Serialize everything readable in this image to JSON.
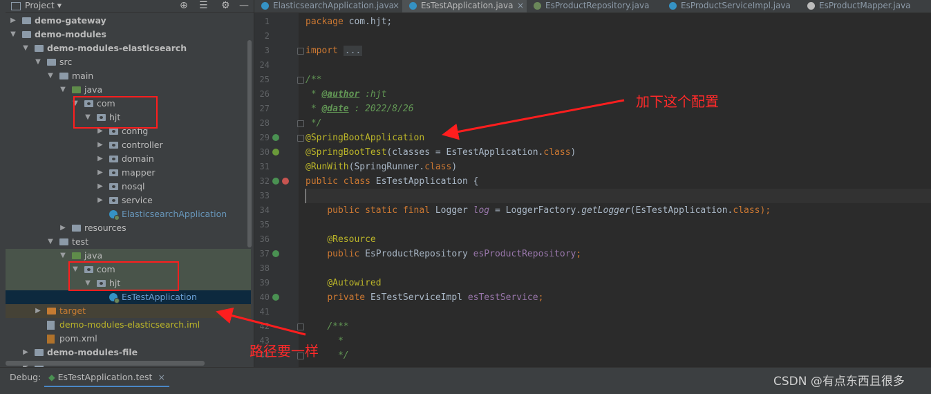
{
  "project_panel": {
    "title": "Project",
    "tree": [
      {
        "label": "demo-gateway",
        "bold": true,
        "indent": 0,
        "arrow": "right",
        "icon": "module"
      },
      {
        "label": "demo-modules",
        "bold": true,
        "indent": 0,
        "arrow": "down",
        "icon": "module"
      },
      {
        "label": "demo-modules-elasticsearch",
        "bold": true,
        "indent": 1,
        "arrow": "down",
        "icon": "module"
      },
      {
        "label": "src",
        "indent": 2,
        "arrow": "down",
        "icon": "folder"
      },
      {
        "label": "main",
        "indent": 3,
        "arrow": "down",
        "icon": "folder"
      },
      {
        "label": "java",
        "indent": 4,
        "arrow": "down",
        "icon": "source-folder"
      },
      {
        "label": "com",
        "indent": 5,
        "arrow": "down",
        "icon": "package"
      },
      {
        "label": "hjt",
        "indent": 6,
        "arrow": "down",
        "icon": "package"
      },
      {
        "label": "config",
        "indent": 7,
        "arrow": "right",
        "icon": "package"
      },
      {
        "label": "controller",
        "indent": 7,
        "arrow": "right",
        "icon": "package"
      },
      {
        "label": "domain",
        "indent": 7,
        "arrow": "right",
        "icon": "package"
      },
      {
        "label": "mapper",
        "indent": 7,
        "arrow": "right",
        "icon": "package"
      },
      {
        "label": "nosql",
        "indent": 7,
        "arrow": "right",
        "icon": "package"
      },
      {
        "label": "service",
        "indent": 7,
        "arrow": "right",
        "icon": "package"
      },
      {
        "label": "ElasticsearchApplication",
        "indent": 7,
        "arrow": "none",
        "icon": "spring-class",
        "color": "#6897bb"
      },
      {
        "label": "resources",
        "indent": 4,
        "arrow": "right",
        "icon": "resources"
      },
      {
        "label": "test",
        "indent": 3,
        "arrow": "down",
        "icon": "folder"
      },
      {
        "label": "java",
        "indent": 4,
        "arrow": "down",
        "icon": "test-folder",
        "zone": "test"
      },
      {
        "label": "com",
        "indent": 5,
        "arrow": "down",
        "icon": "package",
        "zone": "test"
      },
      {
        "label": "hjt",
        "indent": 6,
        "arrow": "down",
        "icon": "package",
        "zone": "test"
      },
      {
        "label": "EsTestApplication",
        "indent": 7,
        "arrow": "none",
        "icon": "spring-class",
        "color": "#6a9fd4",
        "selected": true
      },
      {
        "label": "target",
        "indent": 2,
        "arrow": "right",
        "icon": "excluded-folder",
        "color": "#c57b32",
        "zone": "excluded"
      },
      {
        "label": "demo-modules-elasticsearch.iml",
        "indent": 2,
        "arrow": "none",
        "icon": "iml-file",
        "color": "#bbb529"
      },
      {
        "label": "pom.xml",
        "indent": 2,
        "arrow": "none",
        "icon": "maven-file"
      },
      {
        "label": "demo-modules-file",
        "bold": true,
        "indent": 1,
        "arrow": "right",
        "icon": "module"
      },
      {
        "label": "demo-modules-system",
        "bold": true,
        "indent": 1,
        "arrow": "right",
        "icon": "module",
        "partial": true
      }
    ]
  },
  "tabs": [
    {
      "label": "ElasticsearchApplication.java",
      "icon_color": "#3592c4",
      "closable": true
    },
    {
      "label": "EsTestApplication.java",
      "icon_color": "#3592c4",
      "closable": true,
      "active": true
    },
    {
      "label": "EsProductRepository.java",
      "icon_color": "#6a8759"
    },
    {
      "label": "EsProductServiceImpl.java",
      "icon_color": "#3592c4"
    },
    {
      "label": "EsProductMapper.java",
      "icon_color": "#bbbbbb"
    }
  ],
  "editor": {
    "line_numbers": [
      "1",
      "2",
      "3",
      "24",
      "25",
      "26",
      "27",
      "28",
      "29",
      "30",
      "31",
      "32",
      "33",
      "34",
      "35",
      "36",
      "37",
      "38",
      "39",
      "40",
      "41",
      "42",
      "43",
      "44"
    ],
    "lines": [
      {
        "segs": [
          [
            "kw",
            "package "
          ],
          [
            "",
            "com.hjt;"
          ]
        ]
      },
      {
        "segs": []
      },
      {
        "segs": [
          [
            "kw",
            "import "
          ],
          [
            "fol",
            "..."
          ]
        ]
      },
      {
        "segs": []
      },
      {
        "segs": [
          [
            "cm",
            "/**"
          ]
        ]
      },
      {
        "segs": [
          [
            "cm",
            " * "
          ],
          [
            "tg",
            "@author"
          ],
          [
            "cm",
            " :hjt"
          ]
        ]
      },
      {
        "segs": [
          [
            "cm",
            " * "
          ],
          [
            "tg",
            "@date"
          ],
          [
            "cm",
            " : 2022/8/26"
          ]
        ]
      },
      {
        "segs": [
          [
            "cm",
            " */"
          ]
        ]
      },
      {
        "segs": [
          [
            "an",
            "@SpringBootApplication"
          ]
        ]
      },
      {
        "segs": [
          [
            "an",
            "@SpringBootTest"
          ],
          [
            "",
            "(classes = EsTestApplication."
          ],
          [
            "kw",
            "class"
          ],
          [
            "",
            ")"
          ]
        ]
      },
      {
        "segs": [
          [
            "an",
            "@RunWith"
          ],
          [
            "",
            "(SpringRunner."
          ],
          [
            "kw",
            "class"
          ],
          [
            "",
            ")"
          ]
        ]
      },
      {
        "segs": [
          [
            "kw",
            "public class "
          ],
          [
            "",
            "EsTestApplication {"
          ]
        ]
      },
      {
        "segs": [],
        "current": true
      },
      {
        "segs": [
          [
            "",
            "    "
          ],
          [
            "kw",
            "public static final "
          ],
          [
            "",
            "Logger "
          ],
          [
            "st",
            "log"
          ],
          [
            "",
            " = LoggerFactory."
          ],
          [
            "mth",
            "getLogger"
          ],
          [
            "",
            "(EsTestApplication."
          ],
          [
            "kw",
            "class"
          ],
          [
            "kw",
            ");"
          ]
        ]
      },
      {
        "segs": []
      },
      {
        "segs": [
          [
            "",
            "    "
          ],
          [
            "an",
            "@Resource"
          ]
        ]
      },
      {
        "segs": [
          [
            "",
            "    "
          ],
          [
            "kw",
            "public "
          ],
          [
            "",
            "EsProductRepository "
          ],
          [
            "fld",
            "esProductRepository"
          ],
          [
            "kw",
            ";"
          ]
        ]
      },
      {
        "segs": []
      },
      {
        "segs": [
          [
            "",
            "    "
          ],
          [
            "an",
            "@Autowired"
          ]
        ]
      },
      {
        "segs": [
          [
            "",
            "    "
          ],
          [
            "kw",
            "private "
          ],
          [
            "",
            "EsTestServiceImpl "
          ],
          [
            "fld",
            "esTestService"
          ],
          [
            "kw",
            ";"
          ]
        ]
      },
      {
        "segs": []
      },
      {
        "segs": [
          [
            "",
            "    "
          ],
          [
            "cm",
            "/***"
          ]
        ]
      },
      {
        "segs": [
          [
            "",
            "    "
          ],
          [
            "cm",
            "  *"
          ]
        ]
      },
      {
        "segs": [
          [
            "",
            "    "
          ],
          [
            "cm",
            "  */"
          ]
        ]
      }
    ]
  },
  "annotations": {
    "config_note": "加下这个配置",
    "path_note": "路径要一样"
  },
  "debug": {
    "label": "Debug:",
    "session_tab": "EsTestApplication.test",
    "close": "×"
  },
  "watermark": "CSDN @有点东西且很多",
  "colors": {
    "annotation_red": "#ff1e1e",
    "selection_blue": "#0d293e",
    "test_source_green": "#49544a"
  }
}
